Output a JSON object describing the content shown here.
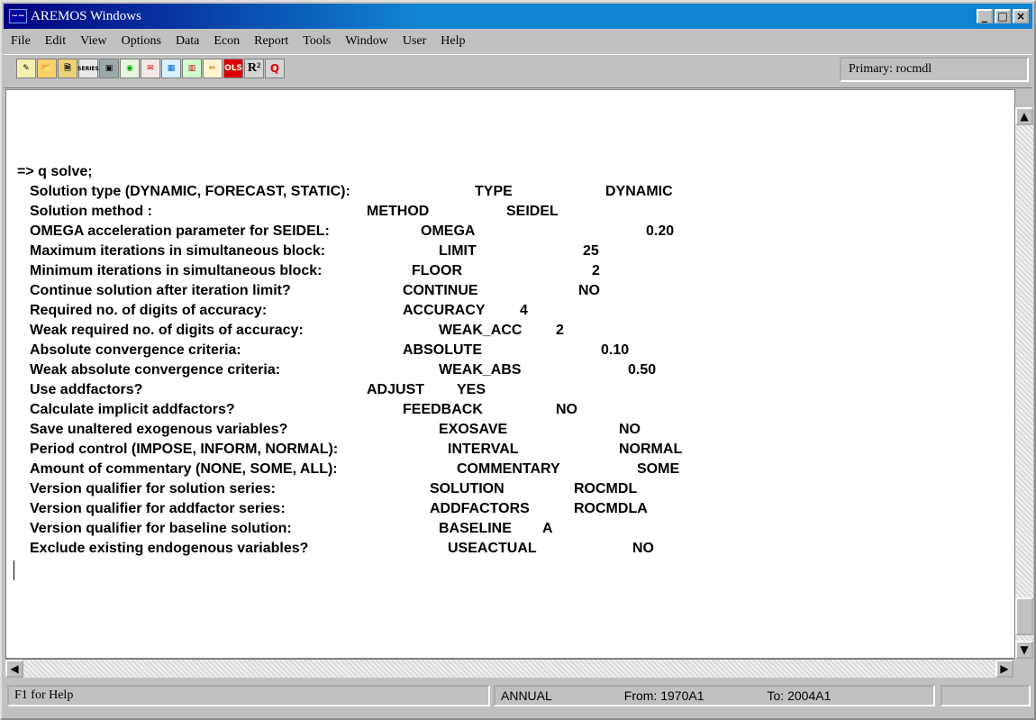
{
  "window": {
    "app_icon_text": "~~",
    "title": "AREMOS Windows",
    "minimize": "_",
    "maximize": "□",
    "close": "×"
  },
  "menu": [
    "File",
    "Edit",
    "View",
    "Options",
    "Data",
    "Econ",
    "Report",
    "Tools",
    "Window",
    "User",
    "Help"
  ],
  "toolbar": {
    "icons": [
      "new-icon",
      "open-icon",
      "clipboard-icon",
      "series-icon",
      "save-icon",
      "globe-icon",
      "envelope-icon",
      "table-icon",
      "chart-icon",
      "pencil-icon",
      "ols-icon",
      "r-squared-icon",
      "q-icon"
    ],
    "ols_label": "OLS",
    "r2_label": "R²",
    "q_label": "Q",
    "series_label": "SERIES",
    "primary_label": "Primary: rocmdl"
  },
  "console": {
    "prompt": "=> q solve;",
    "rows": [
      {
        "label": "Solution type (DYNAMIC, FORECAST, STATIC):",
        "key": "TYPE",
        "value": "DYNAMIC"
      },
      {
        "label": "Solution method :",
        "key": "METHOD",
        "value": "SEIDEL"
      },
      {
        "label": "OMEGA acceleration parameter for SEIDEL:",
        "key": "OMEGA",
        "value": "0.20"
      },
      {
        "label": "Maximum iterations in simultaneous block:",
        "key": "LIMIT",
        "value": "25"
      },
      {
        "label": "Minimum iterations in simultaneous block:",
        "key": "FLOOR",
        "value": "2"
      },
      {
        "label": "Continue solution after iteration limit?",
        "key": "CONTINUE",
        "value": "NO"
      },
      {
        "label": "Required no. of digits of accuracy:",
        "key": "ACCURACY",
        "value": "4"
      },
      {
        "label": "Weak required no. of digits of accuracy:",
        "key": "WEAK_ACC",
        "value": "2"
      },
      {
        "label": "Absolute convergence criteria:",
        "key": "ABSOLUTE",
        "value": "0.10"
      },
      {
        "label": "Weak absolute convergence criteria:",
        "key": "WEAK_ABS",
        "value": "0.50"
      },
      {
        "label": "Use addfactors?",
        "key": "ADJUST",
        "value": "YES"
      },
      {
        "label": "Calculate implicit addfactors?",
        "key": "FEEDBACK",
        "value": "NO"
      },
      {
        "label": "Save unaltered exogenous variables?",
        "key": "EXOSAVE",
        "value": "NO"
      },
      {
        "label": "Period control (IMPOSE, INFORM, NORMAL):",
        "key": "INTERVAL",
        "value": "NORMAL"
      },
      {
        "label": "Amount of commentary (NONE, SOME, ALL):",
        "key": "COMMENTARY",
        "value": "SOME"
      },
      {
        "label": "Version qualifier for solution series:",
        "key": "SOLUTION",
        "value": "ROCMDL"
      },
      {
        "label": "Version qualifier for addfactor series:",
        "key": "ADDFACTORS",
        "value": "ROCMDLA"
      },
      {
        "label": "Version qualifier for baseline solution:",
        "key": "BASELINE",
        "value": "A"
      },
      {
        "label": "Exclude existing endogenous variables?",
        "key": "USEACTUAL",
        "value": "NO"
      }
    ]
  },
  "status": {
    "help": "F1 for Help",
    "frequency": "ANNUAL",
    "from": "From: 1970A1",
    "to": "To: 2004A1"
  }
}
